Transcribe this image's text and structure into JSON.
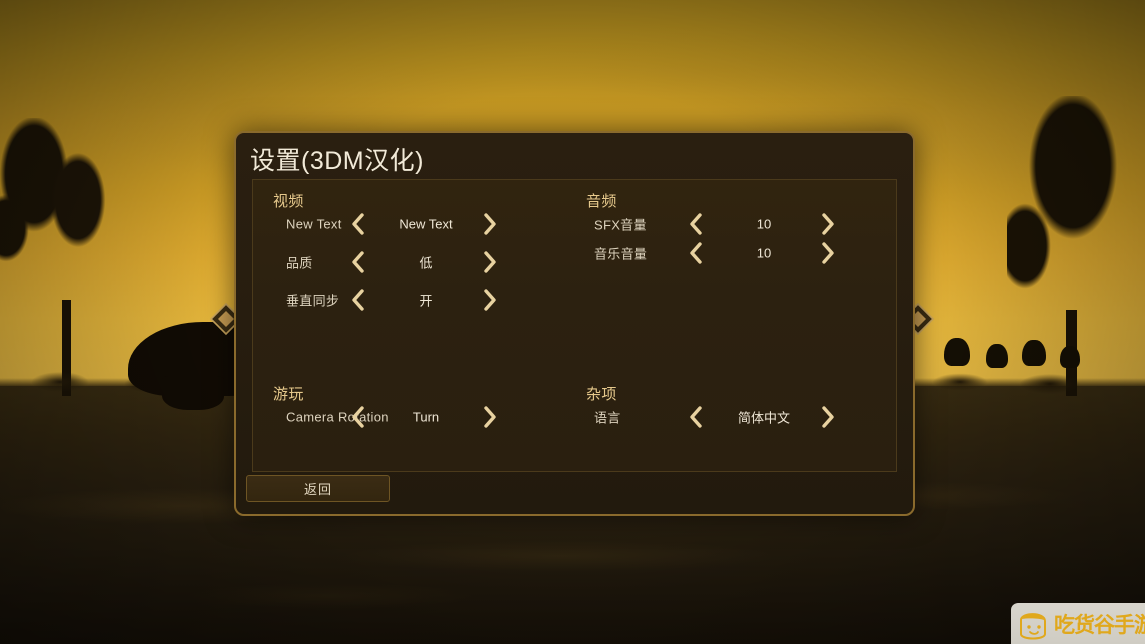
{
  "window": {
    "title": "设置(3DM汉化)",
    "back_label": "返回"
  },
  "groups": {
    "video": {
      "title": "视频",
      "rows": [
        {
          "label": "New Text",
          "value": "New Text"
        },
        {
          "label": "品质",
          "value": "低"
        },
        {
          "label": "垂直同步",
          "value": "开"
        }
      ]
    },
    "audio": {
      "title": "音频",
      "rows": [
        {
          "label": "SFX音量",
          "value": "10"
        },
        {
          "label": "音乐音量",
          "value": "10"
        }
      ]
    },
    "gameplay": {
      "title": "游玩",
      "rows": [
        {
          "label": "Camera Rotation",
          "value": "Turn"
        }
      ]
    },
    "misc": {
      "title": "杂项",
      "rows": [
        {
          "label": "语言",
          "value": "简体中文"
        }
      ]
    }
  },
  "watermark": {
    "text": "吃货谷手游"
  },
  "colors": {
    "panel_border": "#8a6a2c",
    "chevron": "#e8d2a0",
    "group_title": "#e6c98c",
    "value_text": "#efe7d6",
    "watermark_text": "#e0a81c"
  }
}
